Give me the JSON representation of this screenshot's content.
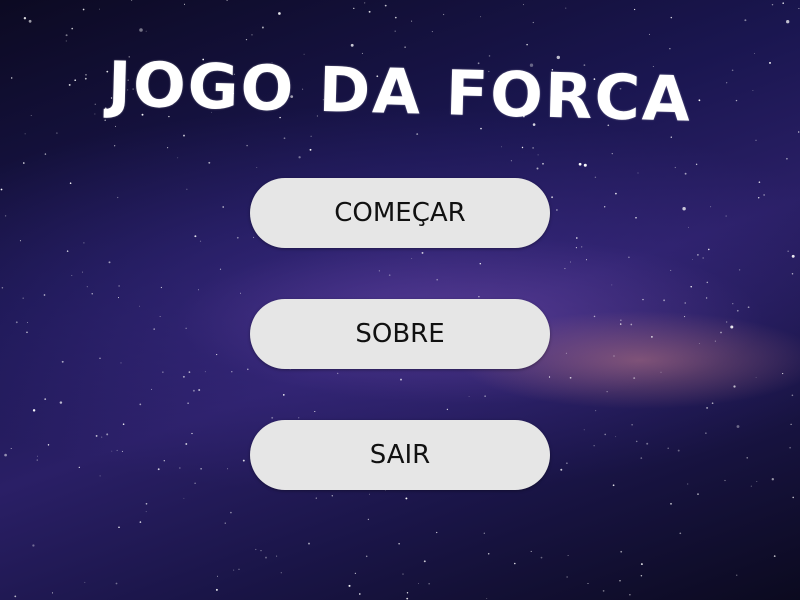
{
  "title": "JOGO DA FORCA",
  "menu": {
    "start_label": "COMEÇAR",
    "about_label": "SOBRE",
    "exit_label": "SAIR"
  },
  "colors": {
    "button_bg": "#e6e6e6",
    "button_text": "#111111",
    "title_text": "#ffffff",
    "sky_dark": "#0c0a22",
    "sky_mid": "#2a1f66"
  }
}
